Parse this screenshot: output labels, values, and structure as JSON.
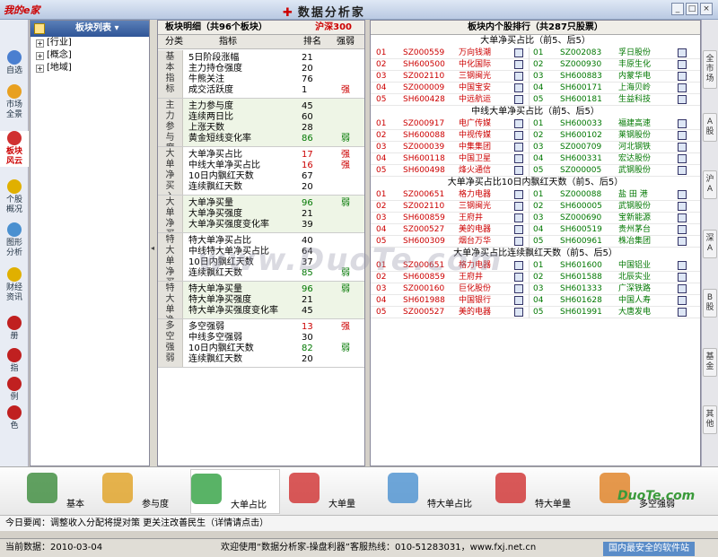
{
  "window": {
    "logo": "我的e家",
    "title": "数据分析家",
    "min": "_",
    "max": "□",
    "close": "×"
  },
  "leftnav": [
    {
      "label": "自选",
      "color": "#4a7fd0"
    },
    {
      "label": "市场\n全景",
      "color": "#e8a020"
    },
    {
      "label": "板块\n风云",
      "color": "#d03030",
      "active": true
    },
    {
      "label": "个股\n概况",
      "color": "#e0b000"
    },
    {
      "label": "图形\n分析",
      "color": "#4a90d0"
    },
    {
      "label": "财经\n资讯",
      "color": "#e0b000"
    },
    {
      "label": "册",
      "color": "#c02020"
    },
    {
      "label": "指",
      "color": "#c02020"
    },
    {
      "label": "例",
      "color": "#c02020"
    },
    {
      "label": "色",
      "color": "#c02020"
    }
  ],
  "tree": {
    "header": "板块列表",
    "nodes": [
      "[行业]",
      "[概念]",
      "[地域]"
    ]
  },
  "mid": {
    "title": "板块明细（共96个板块）",
    "board": "沪深300",
    "cols": {
      "group": "分类",
      "indicator": "指标",
      "rank": "排名",
      "strength": "强弱"
    },
    "groups": [
      {
        "label": "基本指标",
        "rows": [
          {
            "ind": "5日阶段涨幅",
            "rank": "21",
            "str": ""
          },
          {
            "ind": "主力持仓强度",
            "rank": "20",
            "str": ""
          },
          {
            "ind": "牛熊关注",
            "rank": "76",
            "str": ""
          },
          {
            "ind": "成交活跃度",
            "rank": "1",
            "str": "强",
            "strc": "red"
          }
        ]
      },
      {
        "label": "主力参与度",
        "rows": [
          {
            "ind": "主力参与度",
            "rank": "45",
            "str": ""
          },
          {
            "ind": "连续两日比",
            "rank": "60",
            "str": ""
          },
          {
            "ind": "上涨天数",
            "rank": "28",
            "str": ""
          },
          {
            "ind": "黄金短线变化率",
            "rank": "86",
            "rankc": "grn",
            "str": "弱",
            "strc": "grn"
          }
        ]
      },
      {
        "label": "大单净买入",
        "rows": [
          {
            "ind": "大单净买占比",
            "rank": "17",
            "rankc": "red",
            "str": "强",
            "strc": "red"
          },
          {
            "ind": "中线大单净买占比",
            "rank": "16",
            "rankc": "red",
            "str": "强",
            "strc": "red"
          },
          {
            "ind": "10日内飘红天数",
            "rank": "67",
            "str": ""
          },
          {
            "ind": "连续飘红天数",
            "rank": "20",
            "str": ""
          }
        ]
      },
      {
        "label": "大单净买量",
        "rows": [
          {
            "ind": "大单净买量",
            "rank": "96",
            "rankc": "grn",
            "str": "弱",
            "strc": "grn"
          },
          {
            "ind": "大单净买强度",
            "rank": "21",
            "str": ""
          },
          {
            "ind": "大单净买强度变化率",
            "rank": "39",
            "str": ""
          }
        ]
      },
      {
        "label": "特大单净买入",
        "rows": [
          {
            "ind": "特大单净买占比",
            "rank": "40",
            "str": ""
          },
          {
            "ind": "中线特大单净买占比",
            "rank": "64",
            "str": ""
          },
          {
            "ind": "10日内飘红天数",
            "rank": "37",
            "str": ""
          },
          {
            "ind": "连续飘红天数",
            "rank": "85",
            "rankc": "grn",
            "str": "弱",
            "strc": "grn"
          }
        ]
      },
      {
        "label": "特大单净买量",
        "rows": [
          {
            "ind": "特大单净买量",
            "rank": "96",
            "rankc": "grn",
            "str": "弱",
            "strc": "grn"
          },
          {
            "ind": "特大单净买强度",
            "rank": "21",
            "str": ""
          },
          {
            "ind": "特大单净买强度变化率",
            "rank": "45",
            "str": ""
          }
        ]
      },
      {
        "label": "多空强弱",
        "rows": [
          {
            "ind": "多空强弱",
            "rank": "13",
            "rankc": "red",
            "str": "强",
            "strc": "red"
          },
          {
            "ind": "中线多空强弱",
            "rank": "30",
            "str": ""
          },
          {
            "ind": "10日内飘红天数",
            "rank": "82",
            "rankc": "grn",
            "str": "弱",
            "strc": "grn"
          },
          {
            "ind": "连续飘红天数",
            "rank": "20",
            "str": ""
          }
        ]
      }
    ]
  },
  "right": {
    "title": "板块内个股排行（共287只股票）",
    "sections": [
      {
        "title": "大单净买占比（前5、后5）",
        "rows": [
          [
            "01",
            "SZ000559",
            "万向钱潮",
            "01",
            "SZ002083",
            "孚日股份"
          ],
          [
            "02",
            "SH600500",
            "中化国际",
            "02",
            "SZ000930",
            "丰原生化"
          ],
          [
            "03",
            "SZ002110",
            "三钢闽光",
            "03",
            "SH600883",
            "内蒙华电"
          ],
          [
            "04",
            "SZ000009",
            "中国宝安",
            "04",
            "SH600171",
            "上海贝岭"
          ],
          [
            "05",
            "SH600428",
            "中远航运",
            "05",
            "SH600181",
            "生益科技"
          ]
        ]
      },
      {
        "title": "中线大单净买占比（前5、后5）",
        "rows": [
          [
            "01",
            "SZ000917",
            "电广传媒",
            "01",
            "SH600033",
            "福建高速"
          ],
          [
            "02",
            "SH600088",
            "中视传媒",
            "02",
            "SH600102",
            "莱钢股份"
          ],
          [
            "03",
            "SZ000039",
            "中集集团",
            "03",
            "SZ000709",
            "河北钢铁"
          ],
          [
            "04",
            "SH600118",
            "中国卫星",
            "04",
            "SH600331",
            "宏达股份"
          ],
          [
            "05",
            "SH600498",
            "烽火通信",
            "05",
            "SZ000005",
            "武钢股份"
          ]
        ]
      },
      {
        "title": "大单净买占比10日内飘红天数（前5、后5）",
        "rows": [
          [
            "01",
            "SZ000651",
            "格力电器",
            "01",
            "SZ000088",
            "盐 田 港"
          ],
          [
            "02",
            "SZ002110",
            "三钢闽光",
            "02",
            "SH600005",
            "武钢股份"
          ],
          [
            "03",
            "SH600859",
            "王府井",
            "03",
            "SZ000690",
            "宝新能源"
          ],
          [
            "04",
            "SZ000527",
            "美的电器",
            "04",
            "SH600519",
            "贵州茅台"
          ],
          [
            "05",
            "SH600309",
            "烟台万华",
            "05",
            "SH600961",
            "株冶集团"
          ]
        ]
      },
      {
        "title": "大单净买占比连续飘红天数（前5、后5）",
        "rows": [
          [
            "01",
            "SZ000651",
            "格力电器",
            "01",
            "SH601600",
            "中国铝业"
          ],
          [
            "02",
            "SH600859",
            "王府井",
            "02",
            "SH601588",
            "北辰实业"
          ],
          [
            "03",
            "SZ000160",
            "巨化股份",
            "03",
            "SH601333",
            "广深铁路"
          ],
          [
            "04",
            "SH601988",
            "中国银行",
            "04",
            "SH601628",
            "中国人寿"
          ],
          [
            "05",
            "SZ000527",
            "美的电器",
            "05",
            "SH601991",
            "大唐发电"
          ]
        ]
      }
    ]
  },
  "rightnav": [
    "全市场",
    "A股",
    "沪A",
    "深A",
    "B股",
    "基金",
    "其他"
  ],
  "toolbar": [
    {
      "label": "基本",
      "color": "#3a8a3a"
    },
    {
      "label": "参与度",
      "color": "#e0a020"
    },
    {
      "label": "大单占比",
      "color": "#30a040",
      "active": true
    },
    {
      "label": "大单量",
      "color": "#d03030"
    },
    {
      "label": "特大单占比",
      "color": "#4a90d0"
    },
    {
      "label": "特大单量",
      "color": "#d03030"
    },
    {
      "label": "多空强弱",
      "color": "#e08020"
    }
  ],
  "news": "今日要闻：调整收入分配将提对策 更关注改善民生（详情请点击）",
  "status": {
    "date": "当前数据：2010-03-04",
    "welcome": "欢迎使用“数据分析家-操盘利器”客服热线：010-51283031，www.fxj.net.cn"
  },
  "watermark": {
    "main": "www.DuoTe.com",
    "site": "DuoTe.com",
    "footer": "国内最安全的软件站"
  }
}
